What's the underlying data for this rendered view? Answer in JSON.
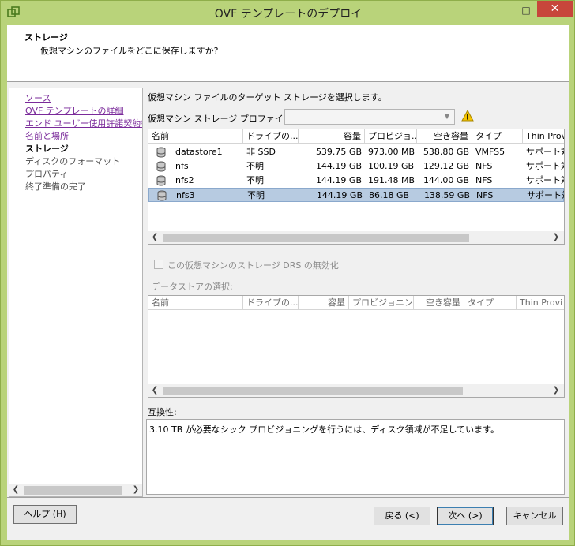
{
  "window": {
    "title": "OVF テンプレートのデプロイ"
  },
  "header": {
    "title": "ストレージ",
    "subtitle": "仮想マシンのファイルをどこに保存しますか?"
  },
  "nav": {
    "items": [
      {
        "label": "ソース",
        "state": "link"
      },
      {
        "label": "OVF テンプレートの詳細",
        "state": "link"
      },
      {
        "label": "エンド ユーザー使用許諾契約書",
        "state": "link"
      },
      {
        "label": "名前と場所",
        "state": "link"
      },
      {
        "label": "ストレージ",
        "state": "current"
      },
      {
        "label": "ディスクのフォーマット",
        "state": "disabled"
      },
      {
        "label": "プロパティ",
        "state": "disabled"
      },
      {
        "label": "終了準備の完了",
        "state": "disabled"
      }
    ]
  },
  "main": {
    "instruction": "仮想マシン ファイルのターゲット ストレージを選択します。",
    "profile_label": "仮想マシン ストレージ プロファイル:",
    "profile_value": "",
    "storage_table": {
      "columns": [
        "名前",
        "ドライブの...",
        "容量",
        "プロビジョ...",
        "空き容量",
        "タイプ",
        "Thin Prov"
      ],
      "rows": [
        {
          "name": "datastore1",
          "drive": "非 SSD",
          "capacity": "539.75 GB",
          "provisioned": "973.00 MB",
          "free": "538.80 GB",
          "type": "VMFS5",
          "thin": "サポート対",
          "selected": false
        },
        {
          "name": "nfs",
          "drive": "不明",
          "capacity": "144.19 GB",
          "provisioned": "100.19 GB",
          "free": "129.12 GB",
          "type": "NFS",
          "thin": "サポート対",
          "selected": false
        },
        {
          "name": "nfs2",
          "drive": "不明",
          "capacity": "144.19 GB",
          "provisioned": "191.48 MB",
          "free": "144.00 GB",
          "type": "NFS",
          "thin": "サポート対",
          "selected": false
        },
        {
          "name": "nfs3",
          "drive": "不明",
          "capacity": "144.19 GB",
          "provisioned": "86.18 GB",
          "free": "138.59 GB",
          "type": "NFS",
          "thin": "サポート対",
          "selected": true
        }
      ]
    },
    "drs_checkbox_label": "この仮想マシンのストレージ DRS の無効化",
    "drs_checked": false,
    "datastore_select_label": "データストアの選択:",
    "datastore_table": {
      "columns": [
        "名前",
        "ドライブの...",
        "容量",
        "プロビジョニン...",
        "空き容量",
        "タイプ",
        "Thin Provi"
      ]
    },
    "compat_label": "互換性:",
    "compat_text": "3.10 TB が必要なシック プロビジョニングを行うには、ディスク領域が不足しています。"
  },
  "footer": {
    "help": "ヘルプ (H)",
    "back": "戻る (<)",
    "next": "次へ (>)",
    "cancel": "キャンセル"
  },
  "icons": {
    "app": "vsphere-app-icon",
    "warning": "warning-icon",
    "datastore": "datastore-icon"
  },
  "colors": {
    "titlebar": "#b9d37a",
    "close": "#c7463b",
    "selection": "#b7cbe1",
    "link": "#7a2a9a"
  }
}
